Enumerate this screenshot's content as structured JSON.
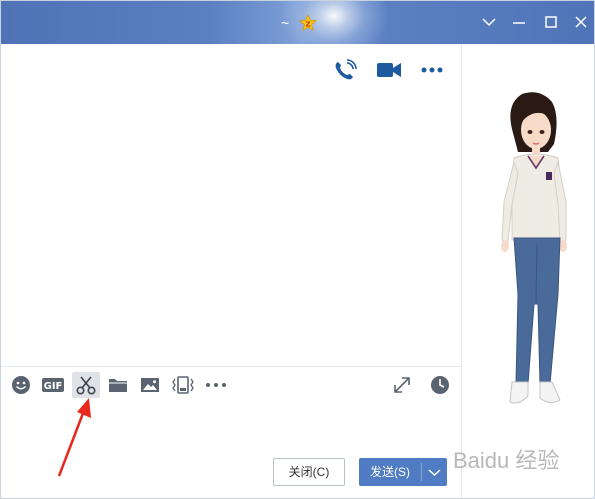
{
  "titlebar": {
    "title": "~",
    "badge_icon": "qq-star-badge-icon",
    "controls": [
      "chevron-down-icon",
      "minimize-icon",
      "maximize-icon",
      "close-icon"
    ]
  },
  "chat_header_actions": [
    "voice-call-icon",
    "video-call-icon",
    "more-icon"
  ],
  "toolbar": {
    "left_icons": [
      "emoji-icon",
      "gif-icon",
      "scissors-icon",
      "folder-icon",
      "image-icon",
      "shake-window-icon",
      "more-icon"
    ],
    "gif_label": "GIF",
    "right_icons": [
      "expand-icon",
      "history-icon"
    ]
  },
  "footer": {
    "close_label": "关闭(C)",
    "send_label": "发送(S)"
  },
  "watermark": {
    "text": "Baidu 经验"
  },
  "colors": {
    "titlebar": "#5478bb",
    "send_button": "#4f7cc2",
    "icon": "#1e5aa0",
    "annotation_arrow": "#e8281e"
  }
}
